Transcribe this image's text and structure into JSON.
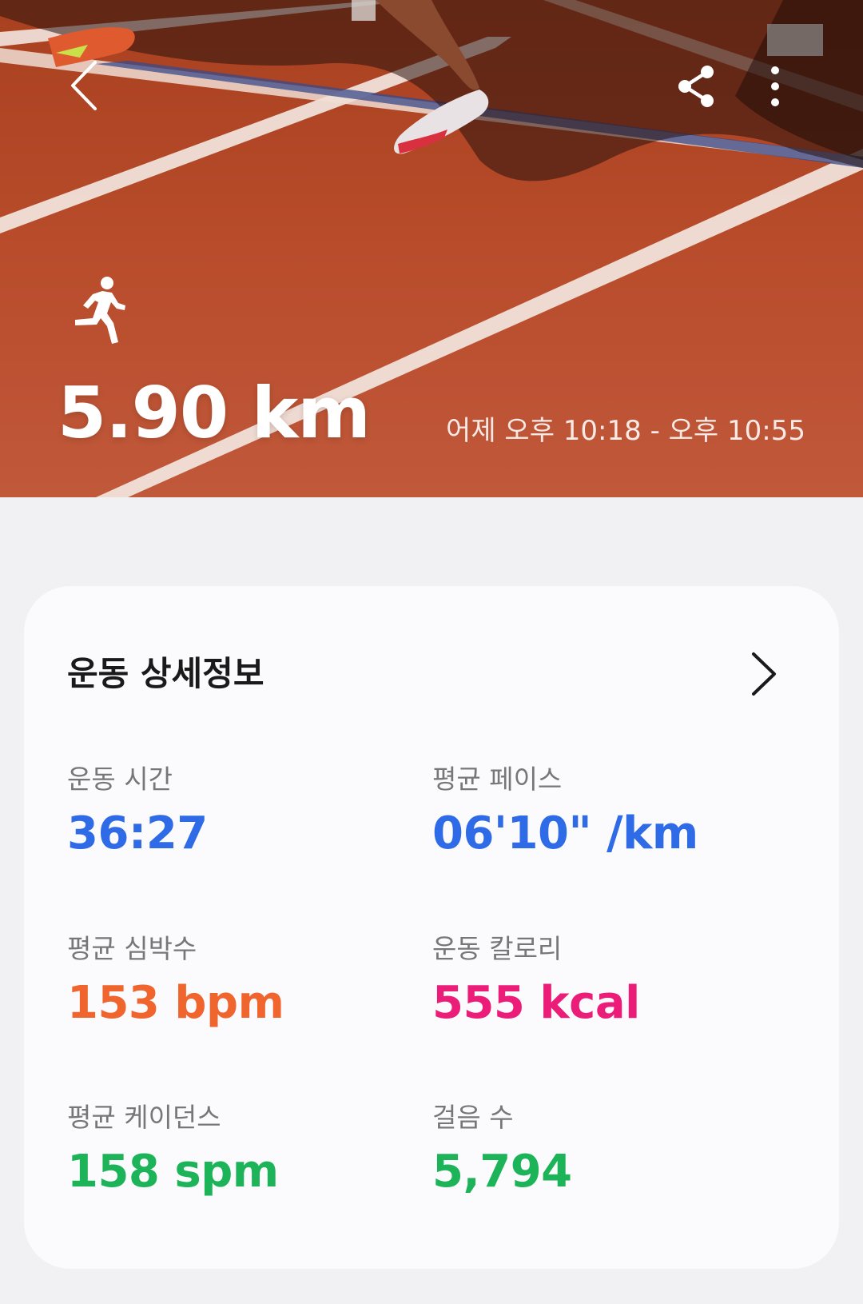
{
  "colors": {
    "track": "#b84a2a",
    "time_value": "#2f6be6",
    "pace_value": "#2f6be6",
    "heart_rate_value": "#f0642d",
    "calories_value": "#ec1c79",
    "cadence_value": "#1cb359",
    "steps_value": "#1cb359"
  },
  "header": {
    "back_icon": "chevron-left-icon",
    "share_icon": "share-icon",
    "more_icon": "more-vertical-icon",
    "activity_icon": "running-person-icon",
    "distance": "5.90 km",
    "time_range": "어제 오후 10:18 - 오후 10:55"
  },
  "details": {
    "title": "운동 상세정보",
    "chevron_icon": "chevron-right-icon",
    "stats": [
      {
        "label": "운동 시간",
        "value": "36:27"
      },
      {
        "label": "평균 페이스",
        "value": "06'10\" /km"
      },
      {
        "label": "평균 심박수",
        "value": "153 bpm"
      },
      {
        "label": "운동 칼로리",
        "value": "555 kcal"
      },
      {
        "label": "평균 케이던스",
        "value": "158 spm"
      },
      {
        "label": "걸음 수",
        "value": "5,794"
      }
    ]
  }
}
